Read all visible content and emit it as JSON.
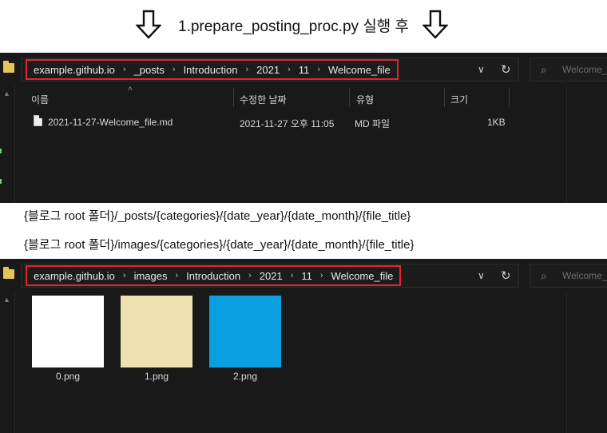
{
  "caption": {
    "text": "1.prepare_posting_proc.py 실행 후",
    "arrow_icon": "down-arrow-outline"
  },
  "window1": {
    "breadcrumbs": [
      "example.github.io",
      "_posts",
      "Introduction",
      "2021",
      "11",
      "Welcome_file"
    ],
    "search_placeholder": "Welcome_f",
    "columns": {
      "name": "이름",
      "modified": "수정한 날짜",
      "type": "유형",
      "size": "크기"
    },
    "files": [
      {
        "name": "2021-11-27-Welcome_file.md",
        "modified": "2021-11-27 오후 11:05",
        "type": "MD 파일",
        "size": "1KB"
      }
    ]
  },
  "labels": {
    "posts_path": "{블로그 root 폴더}/_posts/{categories}/{date_year}/{date_month}/{file_title}",
    "images_path": "{블로그 root 폴더}/images/{categories}/{date_year}/{date_month}/{file_title}"
  },
  "window2": {
    "breadcrumbs": [
      "example.github.io",
      "images",
      "Introduction",
      "2021",
      "11",
      "Welcome_file"
    ],
    "search_placeholder": "Welcome_f",
    "thumbnails": [
      {
        "name": "0.png",
        "color": "#ffffff"
      },
      {
        "name": "1.png",
        "color": "#f0e2b0"
      },
      {
        "name": "2.png",
        "color": "#0a9fe0"
      }
    ]
  },
  "colors": {
    "highlight_border": "#e3242b",
    "explorer_bg": "#191919"
  }
}
